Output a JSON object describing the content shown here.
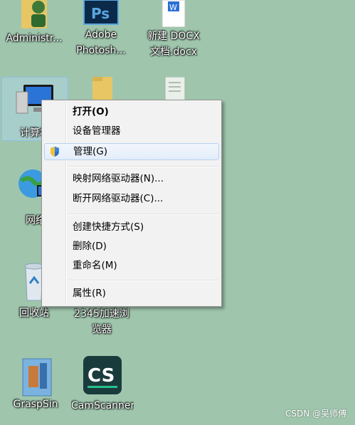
{
  "desktop": {
    "icons": [
      {
        "label": "Administr..."
      },
      {
        "label": "Adobe Photosh..."
      },
      {
        "label": "新建 DOCX 文档.docx"
      },
      {
        "label": "计算机"
      },
      {
        "label": "网络"
      },
      {
        "label": "回收站"
      },
      {
        "label": "2345加速浏览器"
      },
      {
        "label": "GraspSin"
      },
      {
        "label": "CamScanner"
      }
    ]
  },
  "context_menu": {
    "items": [
      {
        "label": "打开(O)",
        "bold": true
      },
      {
        "label": "设备管理器"
      },
      {
        "label": "管理(G)",
        "icon": "uac-shield-icon"
      },
      {
        "label": "映射网络驱动器(N)..."
      },
      {
        "label": "断开网络驱动器(C)..."
      },
      {
        "label": "创建快捷方式(S)"
      },
      {
        "label": "删除(D)"
      },
      {
        "label": "重命名(M)"
      },
      {
        "label": "属性(R)"
      }
    ]
  },
  "watermark": "CSDN @吴师傅",
  "colors": {
    "desktop": "#9fc6ad",
    "menu_bg": "#f2f2f2",
    "hover_border": "#b8d2ef"
  }
}
